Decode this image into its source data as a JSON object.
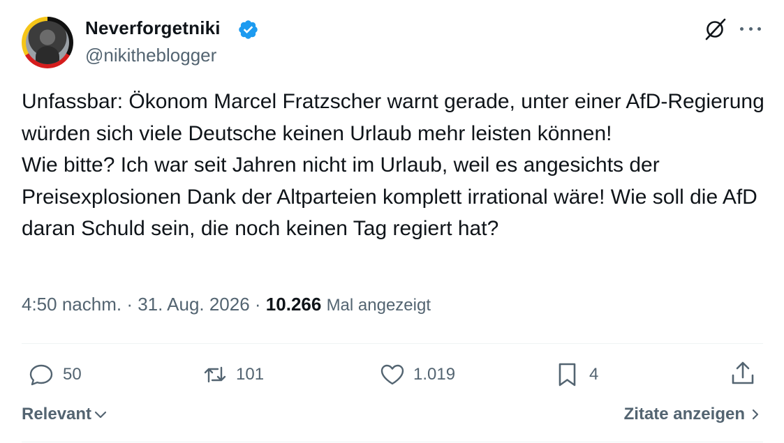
{
  "author": {
    "display_name": "Neverforgetniki",
    "handle": "@nikitheblogger",
    "verified": true
  },
  "tweet": {
    "text": "Unfassbar: Ökonom Marcel Fratzscher warnt gerade, unter einer AfD-Regierung würden sich viele Deutsche keinen Urlaub mehr leisten können!\nWie bitte? Ich war seit Jahren nicht im Urlaub, weil es angesichts der Preisexplosionen Dank der Altparteien komplett irrational wäre! Wie soll die AfD daran Schuld sein, die noch keinen Tag regiert hat?",
    "time": "4:50 nachm.",
    "date": "31. Aug. 2026",
    "separator": " · ",
    "views_count": "10.266",
    "views_label": "Mal angezeigt"
  },
  "actions": {
    "replies": "50",
    "reposts": "101",
    "likes": "1.019",
    "bookmarks": "4"
  },
  "footer": {
    "sort_label": "Relevant",
    "quotes_label": "Zitate anzeigen"
  },
  "colors": {
    "text": "#0f1419",
    "secondary": "#536471",
    "verified": "#1d9bf0",
    "divider": "#eff3f4"
  },
  "icons": [
    "verified-badge-icon",
    "grok-icon",
    "more-icon",
    "reply-icon",
    "repost-icon",
    "like-icon",
    "bookmark-icon",
    "share-icon",
    "chevron-down-icon",
    "chevron-right-icon"
  ]
}
